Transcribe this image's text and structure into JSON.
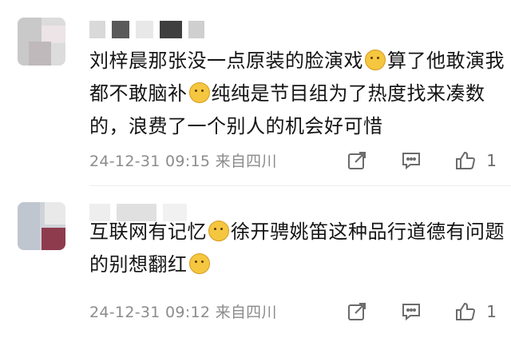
{
  "comments": [
    {
      "parts": [
        {
          "t": "刘梓晨那张没一点原装的脸演戏"
        },
        {
          "e": "doge-emoji"
        },
        {
          "t": "算了他敢演我都不敢脑补"
        },
        {
          "e": "doge-emoji"
        },
        {
          "t": "纯纯是节目组为了热度找来凑数的，浪费了一个别人的机会好可惜"
        }
      ],
      "meta": "24-12-31 09:15 来自四川",
      "likes": "1"
    },
    {
      "parts": [
        {
          "t": "互联网有记忆"
        },
        {
          "e": "smirk-emoji"
        },
        {
          "t": "徐开骋姚笛这种品行道德有问题的别想翻红"
        },
        {
          "e": "smirk-emoji"
        }
      ],
      "meta": "24-12-31 09:12 来自四川",
      "likes": "1"
    }
  ],
  "icons": {
    "share": "share-icon",
    "reply": "comment-icon",
    "like": "thumbs-up-icon"
  },
  "colors": {
    "meta": "#8c8c8c",
    "divider": "#eeeeee"
  }
}
